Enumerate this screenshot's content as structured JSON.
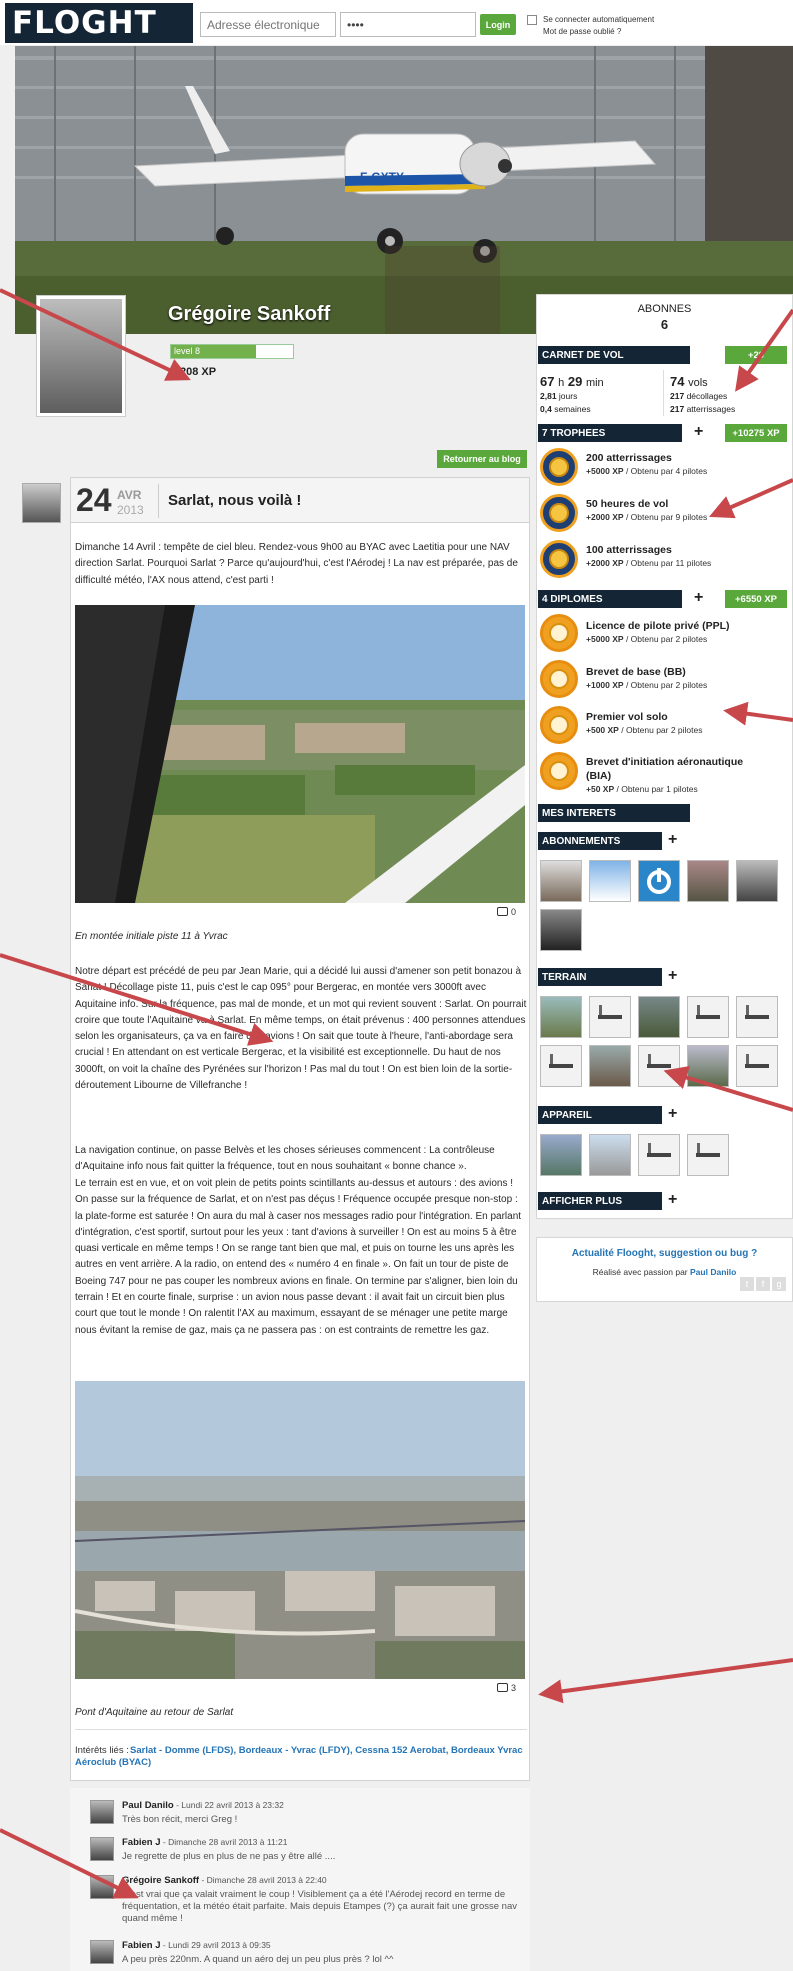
{
  "header": {
    "logo": "FLOGHT",
    "email_placeholder": "Adresse électronique",
    "password_value": "••••",
    "login_label": "Login",
    "auto_login_label": "Se connecter automatiquement",
    "forgot_label": "Mot de passe oublié ?"
  },
  "profile": {
    "name": "Grégoire Sankoff",
    "level": "level 8",
    "level_progress": 0.7,
    "xp": "208 XP",
    "return_label": "Retourner au blog"
  },
  "post": {
    "day": "24",
    "month": "AVR",
    "year": "2013",
    "title": "Sarlat, nous voilà !",
    "intro": "Dimanche 14 Avril : tempête de ciel bleu. Rendez-vous 9h00 au BYAC avec Laetitia pour une NAV direction Sarlat. Pourquoi Sarlat ? Parce qu'aujourd'hui, c'est l'Aérodej ! La nav est préparée, pas de difficulté météo, l'AX nous attend, c'est parti !",
    "photo1_comments": "0",
    "caption1": "En montée initiale piste 11 à Yvrac",
    "para1": "Notre départ est précédé de peu par Jean Marie, qui a décidé lui aussi d'amener son petit bonazou à Sarlat ! Décollage piste 11, puis c'est le cap 095° pour Bergerac, en montée vers 3000ft avec Aquitaine info. Sur la fréquence, pas mal de monde, et un mot qui revient souvent : Sarlat. On pourrait croire que toute l'Aquitaine va à Sarlat. En même temps, on était prévenus : 400 personnes attendues selon les organisateurs, ça va en faire des avions ! On sait que toute à l'heure, l'anti-abordage sera crucial ! En attendant on est verticale Bergerac, et la visibilité est exceptionnelle. Du haut de nos 3000ft, on voit la chaîne des Pyrénées sur l'horizon ! Pas mal du tout ! On est bien loin de la sortie-déroutement Libourne de Villefranche !",
    "para2": "La navigation continue, on passe Belvès et les choses sérieuses commencent : La contrôleuse d'Aquitaine info nous fait quitter la fréquence, tout en nous souhaitant « bonne chance ».",
    "para3": "Le terrain est en vue, et on voit plein de petits points scintillants au-dessus et autours : des avions ! On passe sur la fréquence de Sarlat, et on n'est pas déçus ! Fréquence occupée presque non-stop : la plate-forme est saturée ! On aura du mal à caser nos messages radio pour l'intégration. En parlant d'intégration, c'est sportif, surtout pour les yeux : tant d'avions à surveiller ! On est au moins 5 à être quasi verticale en même temps ! On se range tant bien que mal, et puis on tourne les uns après les autres en vent arrière. A la radio, on entend des « numéro 4 en finale ». On fait un tour de piste de Boeing 747 pour ne pas couper les nombreux avions en finale. On termine par s'aligner, bien loin du terrain ! Et en courte finale, surprise : un avion nous passe devant : il avait fait un circuit bien plus court que tout le monde ! On ralentit l'AX au maximum, essayant de se ménager une petite marge nous évitant la remise de gaz, mais ça ne passera pas : on est contraints de remettre les gaz.",
    "photo2_comments": "3",
    "caption2": "Pont d'Aquitaine au retour de Sarlat",
    "related_label": "Intérêts liés :",
    "related_links": "Sarlat - Domme (LFDS), Bordeaux - Yvrac (LFDY), Cessna 152 Aerobat, Bordeaux Yvrac Aéroclub (BYAC)"
  },
  "comments": [
    {
      "author": "Paul Danilo",
      "date": " - Lundi 22 avril 2013 à 23:32",
      "text": "Très bon récit, merci Greg !"
    },
    {
      "author": "Fabien J",
      "date": " - Dimanche 28 avril 2013 à 11:21",
      "text": "Je regrette de plus en plus de ne pas y être allé ...."
    },
    {
      "author": "Grégoire Sankoff",
      "date": " - Dimanche 28 avril 2013 à 22:40",
      "text": "C'est vrai que ça valait vraiment le coup ! Visiblement ça a été l'Aérodej record en terme de fréquentation, et la météo était parfaite. Mais depuis Etampes (?) ça aurait fait une grosse nav quand même !"
    },
    {
      "author": "Fabien J",
      "date": " - Lundi 29 avril 2013 à 09:35",
      "text": "A peu près 220nm. A quand un aéro dej un peu plus près ? lol ^^"
    }
  ],
  "sidebar": {
    "abonnes_label": "ABONNES",
    "abonnes_count": "6",
    "carnet": {
      "title": "CARNET DE VOL",
      "xp": "+29",
      "hours": "67",
      "h": "h",
      "minutes": "29",
      "min": "min",
      "days": "2,81",
      "days_label": "jours",
      "weeks": "0,4",
      "weeks_label": "semaines",
      "flights": "74",
      "flights_label": "vols",
      "takeoffs": "217",
      "takeoffs_label": "décollages",
      "landings": "217",
      "landings_label": "atterrissages"
    },
    "trophees": {
      "title": "7 TROPHEES",
      "xp": "+10275 XP",
      "items": [
        {
          "name": "200 atterrissages",
          "xp": "+5000 XP",
          "by": " / Obtenu par 4 pilotes"
        },
        {
          "name": "50 heures de vol",
          "xp": "+2000 XP",
          "by": " / Obtenu par 9 pilotes"
        },
        {
          "name": "100 atterrissages",
          "xp": "+2000 XP",
          "by": " / Obtenu par 11 pilotes"
        }
      ]
    },
    "diplomes": {
      "title": "4 DIPLOMES",
      "xp": "+6550 XP",
      "items": [
        {
          "name": "Licence de pilote privé (PPL)",
          "xp": "+5000 XP",
          "by": " / Obtenu par 2 pilotes"
        },
        {
          "name": "Brevet de base (BB)",
          "xp": "+1000 XP",
          "by": " / Obtenu par 2 pilotes"
        },
        {
          "name": "Premier vol solo",
          "xp": "+500 XP",
          "by": " / Obtenu par 2 pilotes"
        },
        {
          "name": "Brevet d'initiation aéronautique",
          "name2": "(BIA)",
          "xp": "+50 XP",
          "by": " / Obtenu par 1 pilotes"
        }
      ]
    },
    "interets": "MES INTERETS",
    "abonnements": "ABONNEMENTS",
    "terrain": "TERRAIN",
    "appareil": "APPAREIL",
    "afficher_plus": "AFFICHER PLUS",
    "plus": "+"
  },
  "footer": {
    "title": "Actualité Flooght, suggestion ou bug ?",
    "made_prefix": "Réalisé avec passion par ",
    "made_author": "Paul Danilo",
    "social": [
      "t",
      "f",
      "g"
    ]
  },
  "colors": {
    "brand_dark": "#142636",
    "accent_green": "#5aa83b",
    "link_blue": "#2574b5",
    "annotation_red": "#c8474a"
  }
}
